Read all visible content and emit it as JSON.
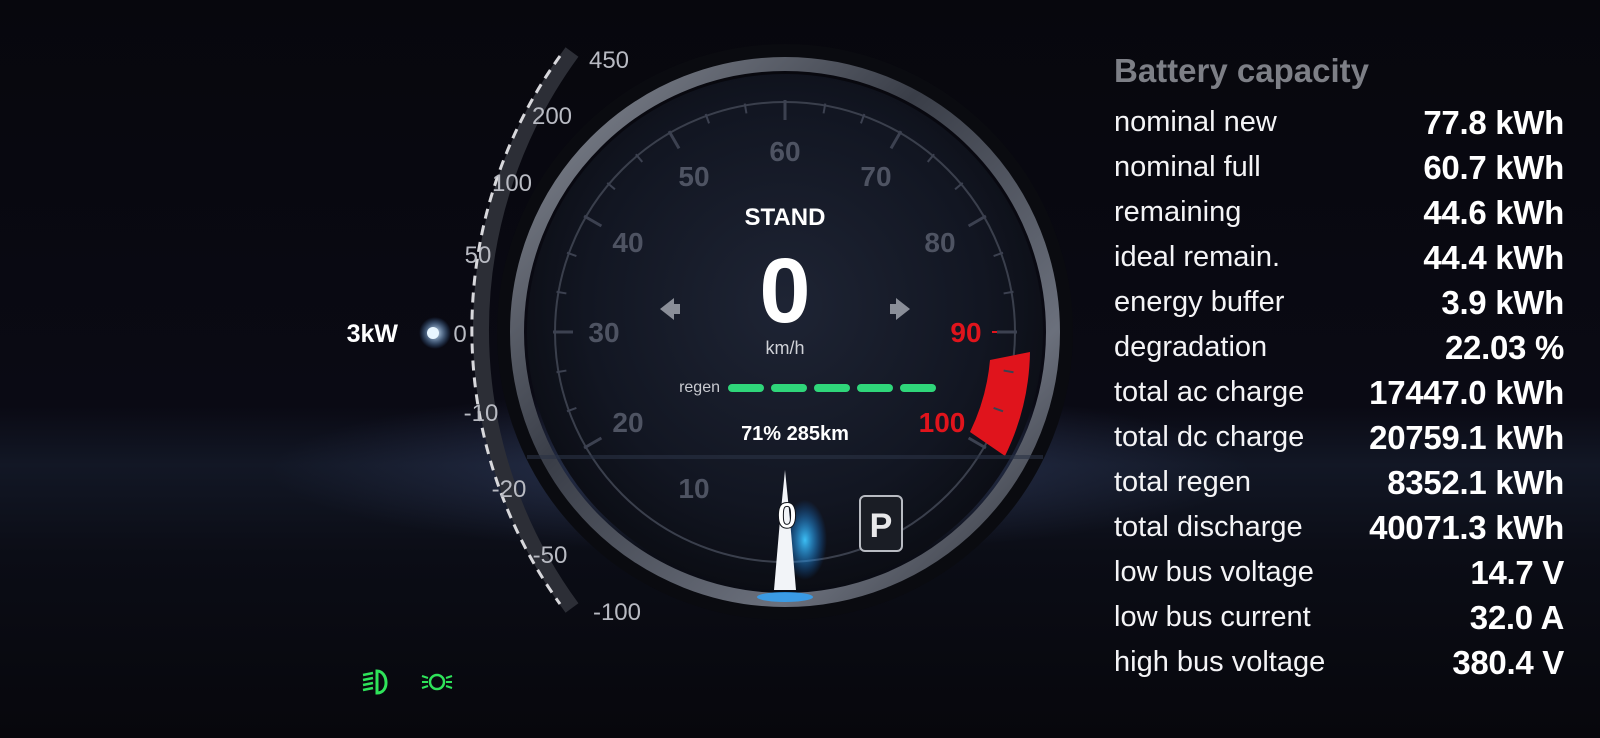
{
  "power_scale": {
    "ticks": [
      "450",
      "200",
      "100",
      "50",
      "0",
      "-10",
      "-20",
      "-50",
      "-100"
    ],
    "current_power_label": "3kW"
  },
  "speedometer": {
    "mode": "STAND",
    "speed": "0",
    "unit": "km/h",
    "tick_labels": [
      "10",
      "20",
      "30",
      "40",
      "50",
      "60",
      "70",
      "80",
      "90",
      "100"
    ],
    "regen_label": "regen",
    "regen_segments_active": 5,
    "soc_range": "71% 285km",
    "needle_value": "0",
    "gear": "P",
    "colors": {
      "redline": "#e0141c",
      "regen": "#2fd67a",
      "needle_glow": "#20b4ff"
    }
  },
  "indicators": [
    {
      "name": "low-beam",
      "color": "#2fe35a"
    },
    {
      "name": "parking-lights",
      "color": "#2fe35a"
    }
  ],
  "battery": {
    "title": "Battery capacity",
    "rows": [
      {
        "label": "nominal new",
        "value": "77.8 kWh"
      },
      {
        "label": "nominal full",
        "value": "60.7 kWh"
      },
      {
        "label": "remaining",
        "value": "44.6 kWh"
      },
      {
        "label": "ideal remain.",
        "value": "44.4 kWh"
      },
      {
        "label": "energy buffer",
        "value": "3.9 kWh"
      },
      {
        "label": "degradation",
        "value": "22.03 %"
      },
      {
        "label": "total ac charge",
        "value": "17447.0 kWh"
      },
      {
        "label": "total dc charge",
        "value": "20759.1 kWh"
      },
      {
        "label": "total regen",
        "value": "8352.1 kWh"
      },
      {
        "label": "total discharge",
        "value": "40071.3 kWh"
      },
      {
        "label": "low bus voltage",
        "value": "14.7 V"
      },
      {
        "label": "low bus current",
        "value": "32.0 A"
      },
      {
        "label": "high bus voltage",
        "value": "380.4 V"
      }
    ]
  }
}
